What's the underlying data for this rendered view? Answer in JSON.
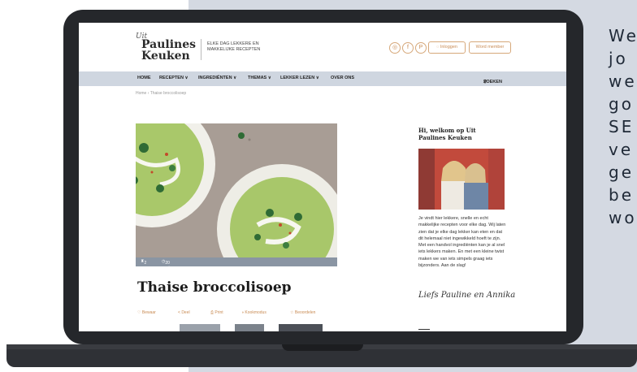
{
  "side_text": {
    "lines": [
      "We",
      "jo",
      "we",
      "go",
      "SE",
      "ve",
      "ge",
      "be",
      "wo"
    ]
  },
  "site": {
    "logo": {
      "prefix": "Uit",
      "line1": "Paulines",
      "line2": "Keuken"
    },
    "tagline": "ELKE DAG LEKKERE EN MAKKELIJKE RECEPTEN",
    "social_icons": [
      "instagram-icon",
      "facebook-icon",
      "pinterest-icon"
    ],
    "social_glyphs": [
      "◎",
      "f",
      "P"
    ],
    "login_label": "Inloggen",
    "member_label": "Word member"
  },
  "nav": {
    "items": [
      "HOME",
      "RECEPTEN ∨",
      "INGREDIËNTEN ∨",
      "THEMAS ∨",
      "LEKKER LEZEN ∨",
      "OVER ONS"
    ],
    "search_label": "ZOEKEN"
  },
  "breadcrumb": "Home › Thaise broccolisoep",
  "hero": {
    "servings": "2 pers.",
    "time": "20 min"
  },
  "recipe": {
    "title": "Thaise broccolisoep",
    "actions": [
      "Bewaar",
      "Deel",
      "Print",
      "Kookmodus",
      "Beoordelen"
    ]
  },
  "sidebar": {
    "welcome_title": "Hi, welkom op Uit Paulines Keuken",
    "intro_text": "Je vindt hier lekkere, snelle en echt makkelijke recepten voor elke dag. Wij laten zien dat je elke dag lekker kan eten en dat dit helemaal niet ingewikkeld hoeft te zijn. Met een handvol ingrediënten kan je al snel iets lekkers maken. En met een kleine twist maken we van iets simpels graag iets bijzonders. Aan de slag!",
    "signature": "Liefs Pauline en Annika"
  },
  "colors": {
    "accent": "#c98c55",
    "nav_bg": "#cfd6e0",
    "panel_bg": "#d4d9e2",
    "laptop": "#25272b"
  }
}
